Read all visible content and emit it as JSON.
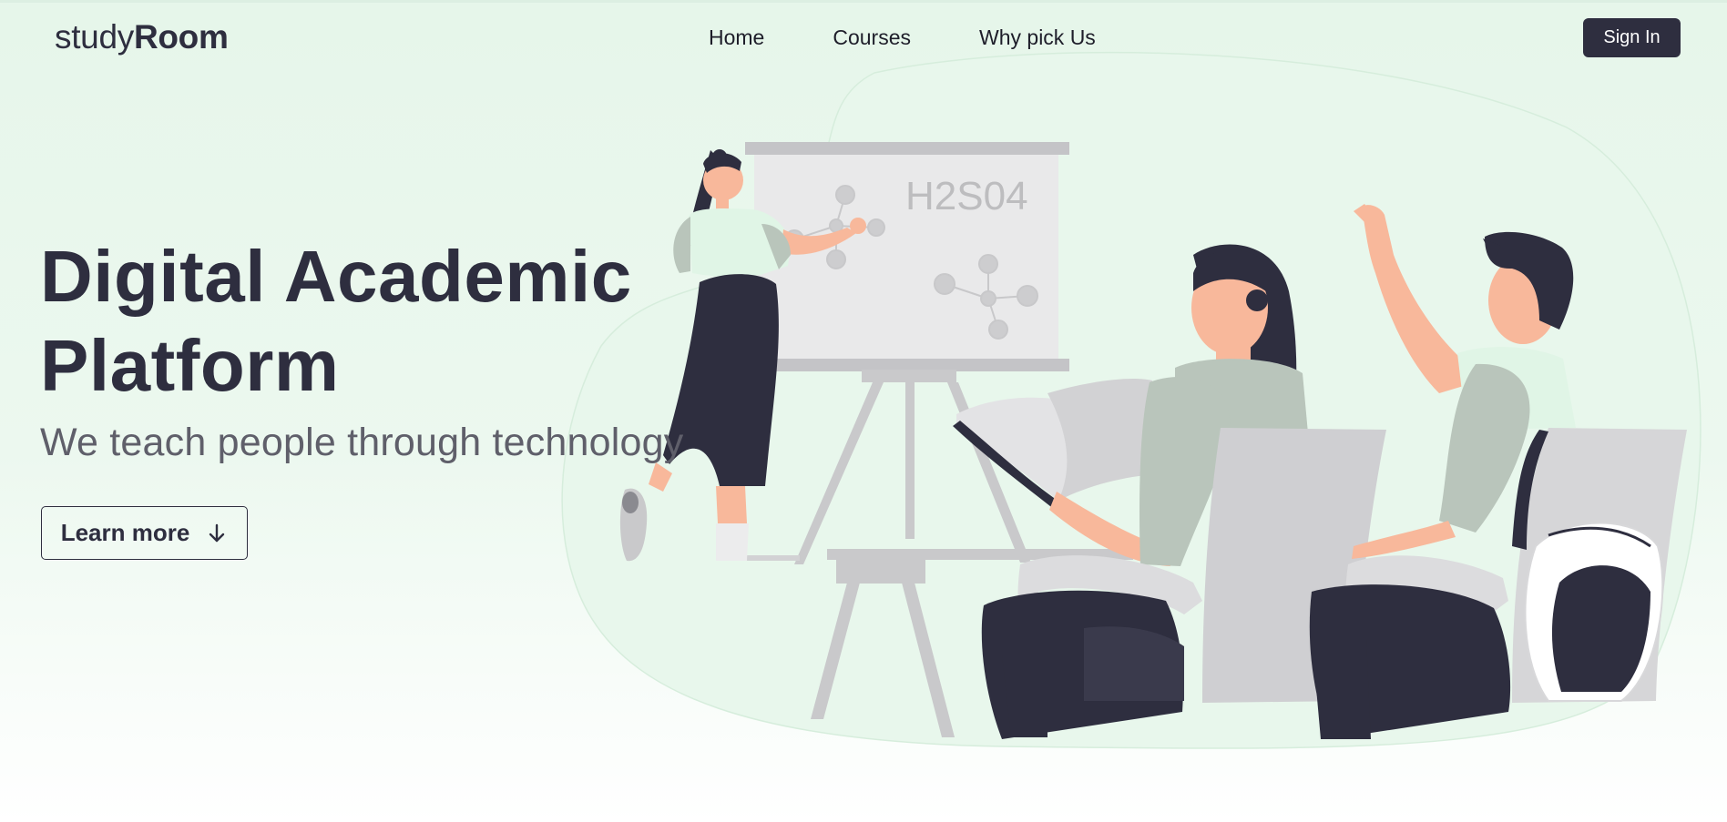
{
  "brand": {
    "prefix": "study",
    "bold": "Room"
  },
  "nav": {
    "items": [
      {
        "label": "Home"
      },
      {
        "label": "Courses"
      },
      {
        "label": "Why pick Us"
      }
    ]
  },
  "header": {
    "signin_label": "Sign In"
  },
  "hero": {
    "title_line1": "Digital Academic",
    "title_line2": "Platform",
    "subtitle": "We teach people through technology",
    "cta_label": "Learn more",
    "cta_icon": "arrow-down-icon"
  },
  "illustration": {
    "whiteboard_text": "H2S04"
  },
  "colors": {
    "dark": "#2e2e3f",
    "mint": "#e6f6ea",
    "blob": "#e8f7ec",
    "skin": "#f8b89b",
    "sage": "#b9c5bb",
    "grey": "#cfcfd2"
  }
}
